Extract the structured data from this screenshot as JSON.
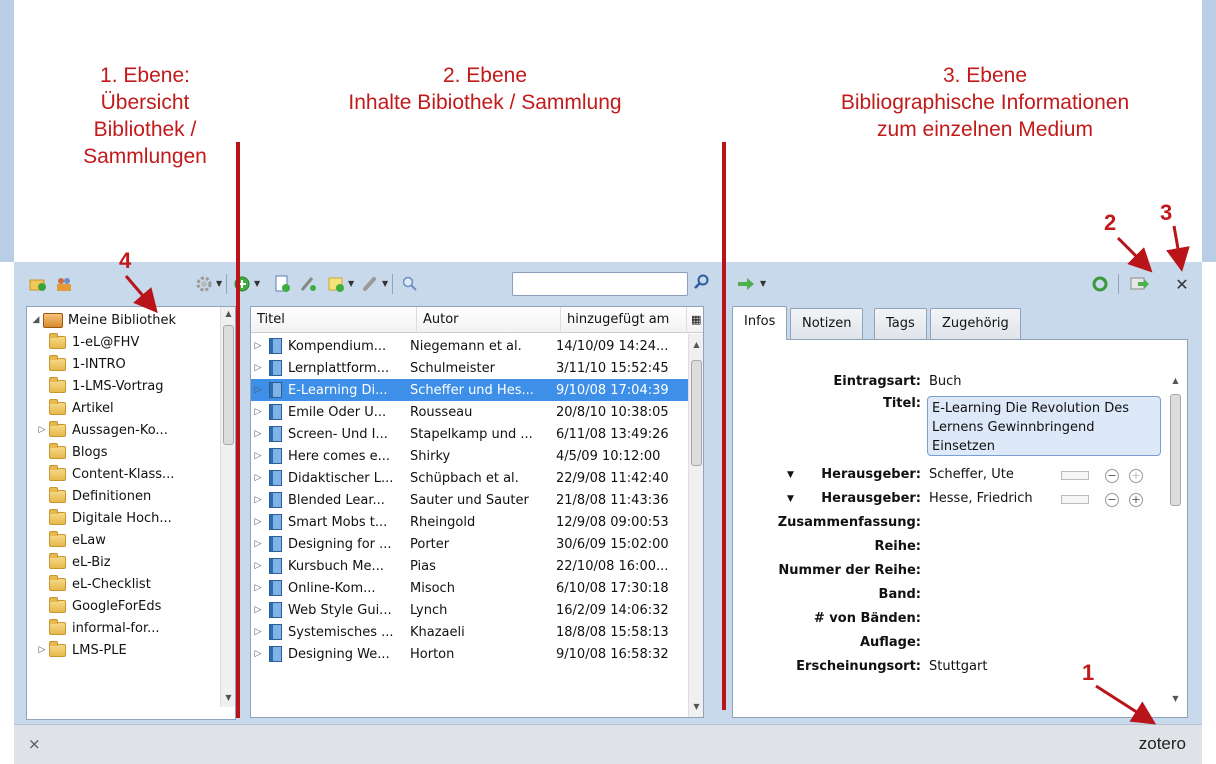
{
  "annotations": {
    "level1": [
      "1. Ebene:",
      "Übersicht",
      "Bibliothek /",
      "Sammlungen"
    ],
    "level2": [
      "2. Ebene",
      "Inhalte Bibiothek / Sammlung"
    ],
    "level3": [
      "3. Ebene",
      "Bibliographische Informationen",
      "zum einzelnen Medium"
    ],
    "markers": [
      "1",
      "2",
      "3",
      "4"
    ]
  },
  "toolbar": {
    "search_value": "",
    "icons": [
      "new-collection-icon",
      "new-group-icon",
      "actions-gear-icon",
      "new-item-icon",
      "new-item-from-page-icon",
      "add-by-identifier-icon",
      "new-note-icon",
      "add-attachment-icon",
      "advanced-search-icon",
      "search-icon",
      "locate-arrow-icon",
      "sync-icon",
      "fullscreen-icon",
      "close-icon"
    ]
  },
  "collections": {
    "library": "Meine Bibliothek",
    "items": [
      "1-eL@FHV",
      "1-INTRO",
      "1-LMS-Vortrag",
      "Artikel",
      "Aussagen-Ko...",
      "Blogs",
      "Content-Klass...",
      "Definitionen",
      "Digitale Hoch...",
      "eLaw",
      "eL-Biz",
      "eL-Checklist",
      "GoogleForEds",
      "informal-for...",
      "LMS-PLE"
    ]
  },
  "items_list": {
    "columns": [
      "Titel",
      "Autor",
      "hinzugefügt am"
    ],
    "rows": [
      [
        "Kompendium...",
        "Niegemann et al.",
        "14/10/09 14:24..."
      ],
      [
        "Lernplattform...",
        "Schulmeister",
        "3/11/10 15:52:45"
      ],
      [
        "E-Learning Di...",
        "Scheffer und Hes...",
        "9/10/08 17:04:39"
      ],
      [
        "Emile Oder Ü...",
        "Rousseau",
        "20/8/10 10:38:05"
      ],
      [
        "Screen- Und I...",
        "Stapelkamp und ...",
        "6/11/08 13:49:26"
      ],
      [
        "Here comes e...",
        "Shirky",
        "4/5/09 10:12:00"
      ],
      [
        "Didaktischer L...",
        "Schüpbach et al.",
        "22/9/08 11:42:40"
      ],
      [
        "Blended Lear...",
        "Sauter und Sauter",
        "21/8/08 11:43:36"
      ],
      [
        "Smart Mobs t...",
        "Rheingold",
        "12/9/08 09:00:53"
      ],
      [
        "Designing for ...",
        "Porter",
        "30/6/09 15:02:00"
      ],
      [
        "Kursbuch Me...",
        "Pias",
        "22/10/08 16:00..."
      ],
      [
        "Online-Kom...",
        "Misoch",
        "6/10/08 17:30:18"
      ],
      [
        "Web Style Gui...",
        "Lynch",
        "16/2/09 14:06:32"
      ],
      [
        "Systemisches ...",
        "Khazaeli",
        "18/8/08 15:58:13"
      ],
      [
        "Designing We...",
        "Horton",
        "9/10/08 16:58:32"
      ]
    ]
  },
  "info": {
    "tabs": [
      "Infos",
      "Notizen",
      "Tags",
      "Zugehörig"
    ],
    "type_label": "Eintragsart:",
    "type_value": "Buch",
    "title_label": "Titel:",
    "title_value": "E-Learning Die Revolution Des Lernens Gewinnbringend Einsetzen",
    "editor_label": "Herausgeber:",
    "editor1": "Scheffer, Ute",
    "editor2": "Hesse, Friedrich",
    "labels": [
      "Zusammenfassung:",
      "Reihe:",
      "Nummer der Reihe:",
      "Band:",
      "# von Bänden:",
      "Auflage:",
      "Erscheinungsort:"
    ],
    "place_value": "Stuttgart"
  },
  "status": {
    "close": "×",
    "brand": "zotero"
  },
  "colors": {
    "annotation_red": "#c21a1a",
    "selection_blue": "#3d8fe8",
    "pane_bg": "#c9d9ec"
  }
}
